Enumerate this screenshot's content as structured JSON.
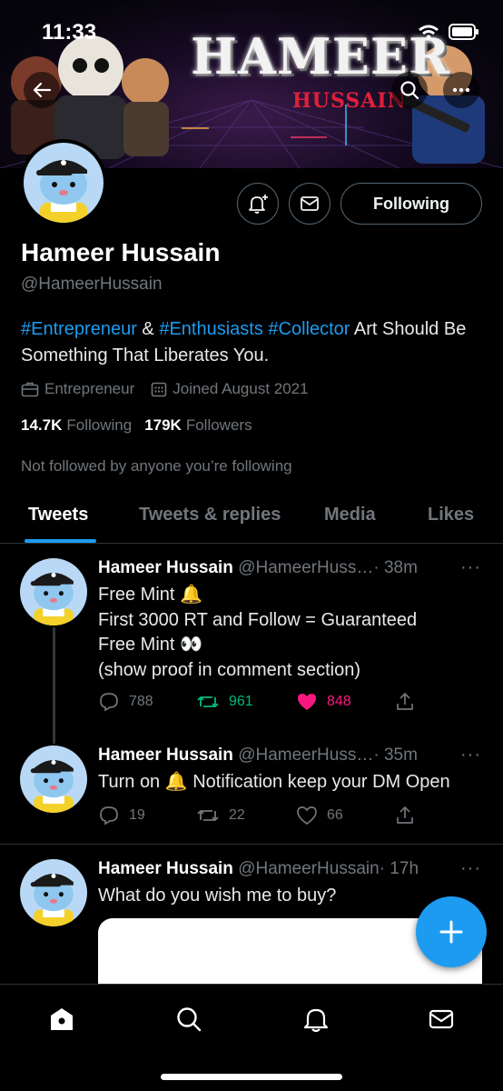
{
  "status_bar": {
    "time": "11:33"
  },
  "banner": {
    "title": "HAMEER",
    "subtitle": "HUSSAIN"
  },
  "profile": {
    "name": "Hameer Hussain",
    "handle": "@HameerHussain",
    "following_button": "Following",
    "bio": {
      "tag1": "#Entrepreneur",
      "amp": " & ",
      "tag2": "#Enthusiasts",
      "space": " ",
      "tag3": "#Collector",
      "text": " Art Should Be Something That Liberates You."
    },
    "category": "Entrepreneur",
    "joined": "Joined August 2021",
    "following_count": "14.7K",
    "following_label": "Following",
    "followers_count": "179K",
    "followers_label": "Followers",
    "not_followed": "Not followed by anyone you’re following"
  },
  "tabs": [
    {
      "label": "Tweets",
      "active": true
    },
    {
      "label": "Tweets & replies",
      "active": false
    },
    {
      "label": "Media",
      "active": false
    },
    {
      "label": "Likes",
      "active": false
    }
  ],
  "tweets": [
    {
      "name": "Hameer Hussain",
      "handle": "@HameerHuss…",
      "time": "· 38m",
      "lines": [
        "Free Mint 🔔",
        "First 3000 RT and Follow  = Guaranteed",
        "Free Mint 👀",
        "(show proof in comment section)"
      ],
      "replies": "788",
      "retweets": "961",
      "likes": "848",
      "retweeted": true,
      "liked": true
    },
    {
      "name": "Hameer Hussain",
      "handle": "@HameerHuss…",
      "time": "· 35m",
      "lines": [
        "Turn on 🔔 Notification keep your DM Open"
      ],
      "replies": "19",
      "retweets": "22",
      "likes": "66",
      "retweeted": false,
      "liked": false
    },
    {
      "name": "Hameer Hussain",
      "handle": "@HameerHussain",
      "time": "· 17h",
      "lines": [
        "What do you wish me to buy?"
      ]
    }
  ],
  "more_glyph": "···",
  "colors": {
    "accent": "#1d9bf0",
    "retweet": "#00ba7c",
    "like": "#f91880",
    "muted": "#71767b"
  },
  "icons": [
    "back-arrow-icon",
    "search-icon",
    "more-icon",
    "bell-plus-icon",
    "mail-icon",
    "briefcase-icon",
    "calendar-icon",
    "reply-icon",
    "retweet-icon",
    "heart-icon",
    "share-icon",
    "compose-plus-icon",
    "home-icon",
    "notifications-icon",
    "messages-icon"
  ]
}
